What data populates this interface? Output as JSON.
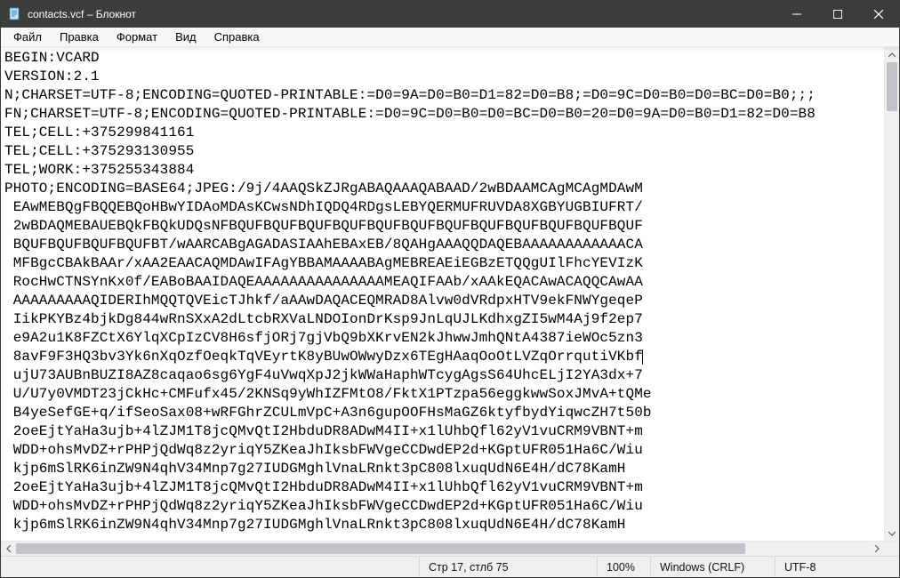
{
  "titlebar": {
    "title": "contacts.vcf – Блокнот"
  },
  "menubar": {
    "items": [
      "Файл",
      "Правка",
      "Формат",
      "Вид",
      "Справка"
    ]
  },
  "content": {
    "lines": [
      "BEGIN:VCARD",
      "VERSION:2.1",
      "N;CHARSET=UTF-8;ENCODING=QUOTED-PRINTABLE:=D0=9A=D0=B0=D1=82=D0=B8;=D0=9C=D0=B0=D0=BC=D0=B0;;;",
      "FN;CHARSET=UTF-8;ENCODING=QUOTED-PRINTABLE:=D0=9C=D0=B0=D0=BC=D0=B0=20=D0=9A=D0=B0=D1=82=D0=B8",
      "TEL;CELL:+375299841161",
      "TEL;CELL:+375293130955",
      "TEL;WORK:+375255343884",
      "PHOTO;ENCODING=BASE64;JPEG:/9j/4AAQSkZJRgABAQAAAQABAAD/2wBDAAMCAgMCAgMDAwM",
      " EAwMEBQgFBQQEBQoHBwYIDAoMDAsKCwsNDhIQDQ4RDgsLEBYQERMUFRUVDA8XGBYUGBIUFRT/",
      " 2wBDAQMEBAUEBQkFBQkUDQsNFBQUFBQUFBQUFBQUFBQUFBQUFBQUFBQUFBQUFBQUFBQUFBQUF",
      " BQUFBQUFBQUFBQUFBT/wAARCABgAGADASIAAhEBAxEB/8QAHgAAAQQDAQEBAAAAAAAAAAAACA",
      " MFBgcCBAkBAAr/xAA2EAACAQMDAwIFAgYBBAMAAAABAgMEBREAEiEGBzETQQgUIlFhcYEVIzK",
      " RocHwCTNSYnKx0f/EABoBAAIDAQEAAAAAAAAAAAAAAAMEAQIFAAb/xAAkEQACAwACAQQCAwAA",
      " AAAAAAAAAQIDERIhMQQTQVEicTJhkf/aAAwDAQACEQMRAD8Alvw0dVRdpxHTV9ekFNWYgeqeP",
      " IikPKYBz4bjkDg844wRnSXxA2dLtcbRXVaLNDOIonDrKsp9JnLqUJLKdhxgZI5wM4Aj9f2ep7",
      " e9A2u1K8FZCtX6YlqXCpIzCV8H6sfjORj7gjVbQ9bXKrvEN2kJhwwJmhQNtA4387ieWOc5zn3",
      " 8avF9F3HQ3bv3Yk6nXqOzfOeqkTqVEyrtK8yBUwOWwyDzx6TEgHAaqOoOtLVZqOrrqutiVKbf",
      " ujU73AUBnBUZI8AZ8caqao6sg6YgF4uVwqXpJ2jkWWaHaphWTcygAgsS64UhcELjI2YA3dx+7",
      " U/U7y0VMDT23jCkHc+CMFufx45/2KNSq9yWhIZFMtO8/FktX1PTzpa56eggkwwSoxJMvA+tQMe",
      " B4yeSefGE+q/ifSeoSax08+wRFGhrZCULmVpC+A3n6gupOOFHsMaGZ6ktyfbydYiqwcZH7t50b",
      " 2oeEjtYaHa3ujb+4lZJM1T8jcQMvQtI2HbduDR8ADwM4II+x1lUhbQfl62yV1vuCRM9VBNT+m",
      " WDD+ohsMvDZ+rPHPjQdWq8z2yriqY5ZKeaJhIksbFWVgeCCDwdEP2d+KGptUFR051Ha6C/Wiu",
      " kjp6mSlRK6inZW9N4qhV34Mnp7g27IUDGMghlVnaLRnkt3pC808lxuqUdN6E4H/dC78KamH",
      " 2oeEjtYaHa3ujb+4lZJM1T8jcQMvQtI2HbduDR8ADwM4II+x1lUhbQfl62yV1vuCRM9VBNT+m",
      " WDD+ohsMvDZ+rPHPjQdWq8z2yriqY5ZKeaJhIksbFWVgeCCDwdEP2d+KGptUFR051Ha6C/Wiu",
      " kjp6mSlRK6inZW9N4qhV34Mnp7g27IUDGMghlVnaLRnkt3pC808lxuqUdN6E4H/dC78KamH"
    ],
    "caret_line": 17,
    "caret_col": 75
  },
  "statusbar": {
    "position": "Стр 17, стлб 75",
    "zoom": "100%",
    "line_ending": "Windows (CRLF)",
    "encoding": "UTF-8"
  },
  "icons": {
    "app": "notepad-icon",
    "minimize": "minimize-icon",
    "maximize": "maximize-icon",
    "close": "close-icon"
  }
}
